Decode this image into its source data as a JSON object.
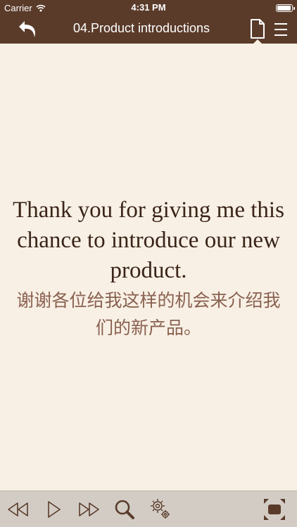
{
  "status_bar": {
    "carrier": "Carrier",
    "time": "4:31 PM"
  },
  "nav": {
    "title": "04.Product introductions",
    "back_icon": "undo-arrow-icon",
    "page_icon": "document-icon",
    "menu_icon": "hamburger-menu-icon"
  },
  "content": {
    "english": "Thank you for giving me this chance to introduce our new product.",
    "chinese": "谢谢各位给我这样的机会来介绍我们的新产品。"
  },
  "toolbar": {
    "icons": [
      "rewind-icon",
      "play-icon",
      "fast-forward-icon",
      "search-icon",
      "settings-icon",
      "fullscreen-icon"
    ]
  },
  "colors": {
    "nav_bar": "#5a3b2a",
    "background": "#f8f0e5",
    "english_text": "#3a2418",
    "chinese_text": "#8a6150",
    "toolbar": "#d2ccc5",
    "toolbar_icon": "#5a3b2a"
  }
}
